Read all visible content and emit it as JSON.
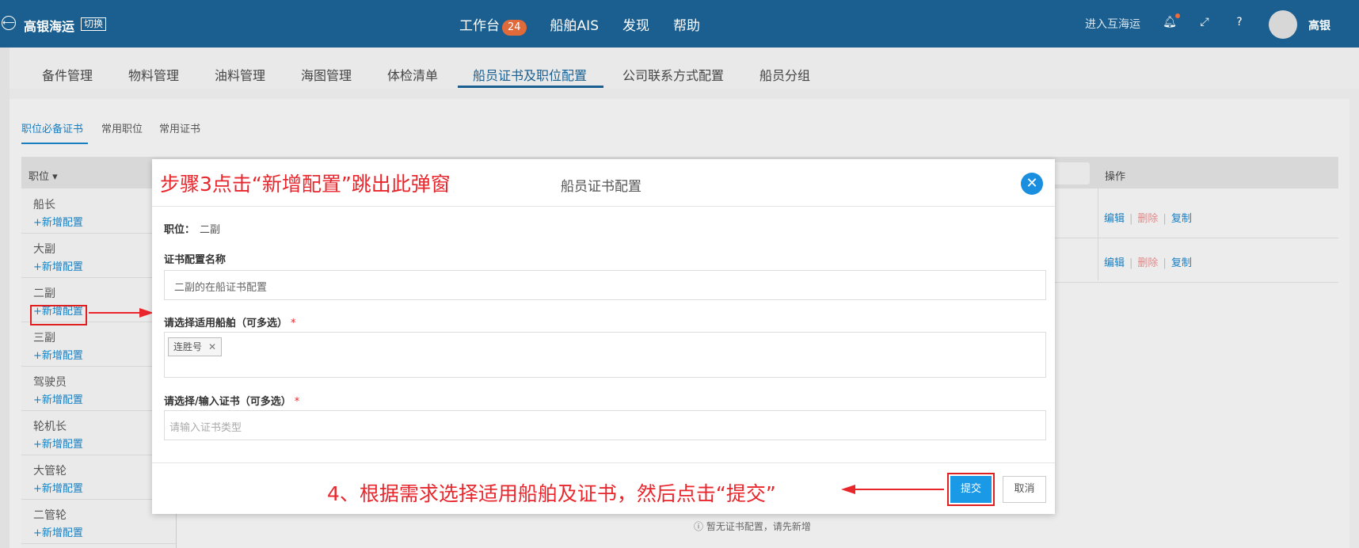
{
  "topbar": {
    "brand": "高银海运",
    "switch_label": "切换",
    "nav": [
      "工作台",
      "船舶AIS",
      "发现",
      "帮助"
    ],
    "workbench_badge": "24",
    "enter_link": "进入互海运",
    "username": "高银"
  },
  "tabs": [
    "备件管理",
    "物料管理",
    "油料管理",
    "海图管理",
    "体检清单",
    "船员证书及职位配置",
    "公司联系方式配置",
    "船员分组"
  ],
  "active_tab": "船员证书及职位配置",
  "subtabs": [
    "职位必备证书",
    "常用职位",
    "常用证书"
  ],
  "table": {
    "col_position": "职位",
    "col_actions": "操作",
    "positions": [
      {
        "name": "船长",
        "add": "+新增配置"
      },
      {
        "name": "大副",
        "add": "+新增配置"
      },
      {
        "name": "二副",
        "add": "+新增配置"
      },
      {
        "name": "三副",
        "add": "+新增配置"
      },
      {
        "name": "驾驶员",
        "add": "+新增配置"
      },
      {
        "name": "轮机长",
        "add": "+新增配置"
      },
      {
        "name": "大管轮",
        "add": "+新增配置"
      },
      {
        "name": "二管轮",
        "add": "+新增配置"
      }
    ],
    "row_actions": {
      "edit": "编辑",
      "delete": "删除",
      "copy": "复制"
    },
    "empty_hint": "ⓘ 暂无证书配置，请先新增"
  },
  "modal": {
    "annotation_step3": "步骤3点击“新增配置”跳出此弹窗",
    "title": "船员证书配置",
    "position_label": "职位：",
    "position_value": "二副",
    "cert_name_label": "证书配置名称",
    "cert_name_value": "二副的在船证书配置",
    "ships_label": "请选择适用船舶（可多选）",
    "ship_tag": "连胜号",
    "certs_label": "请选择/输入证书（可多选）",
    "certs_placeholder": "请输入证书类型",
    "required_mark": "*",
    "annotation_step4": "4、根据需求选择适用船舶及证书，然后点击“提交”",
    "submit": "提交",
    "cancel": "取消"
  }
}
